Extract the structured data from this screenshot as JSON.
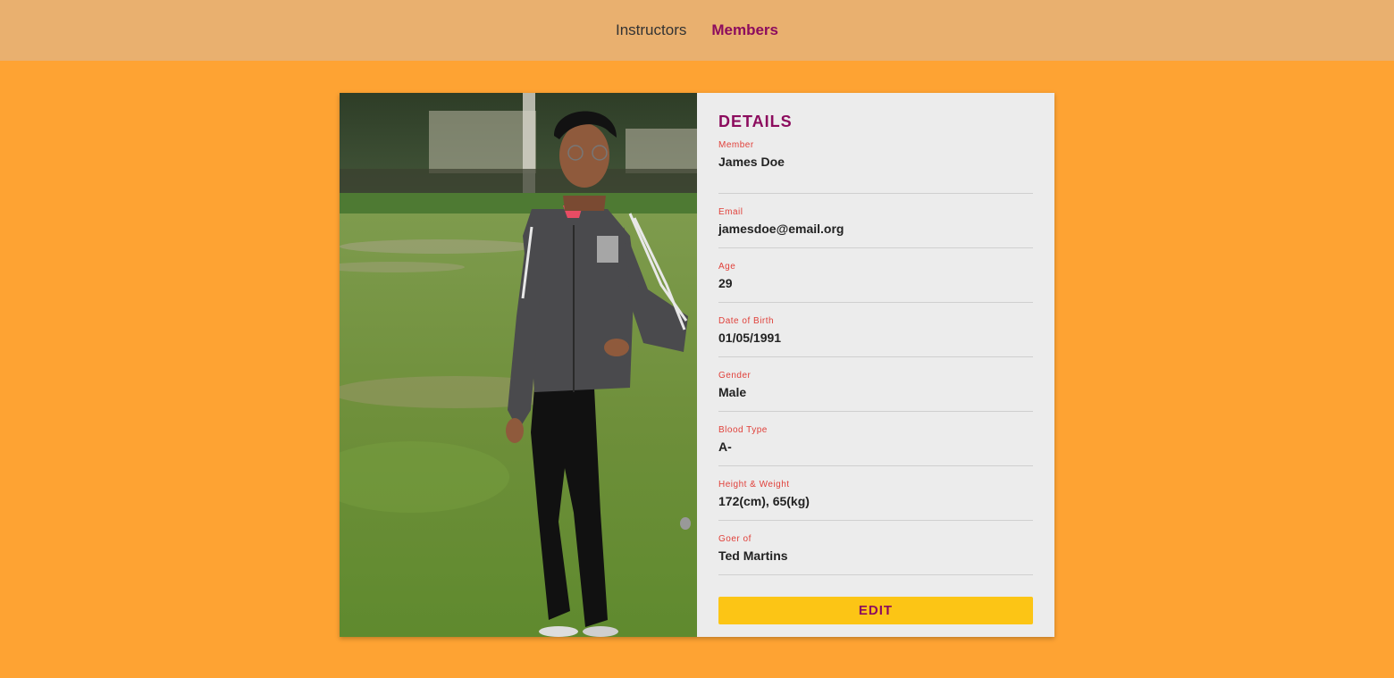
{
  "nav": {
    "items": [
      {
        "label": "Instructors",
        "active": false
      },
      {
        "label": "Members",
        "active": true
      }
    ]
  },
  "details": {
    "title": "DETAILS",
    "fields": [
      {
        "label": "Member",
        "value": "James Doe"
      },
      {
        "label": "Email",
        "value": "jamesdoe@email.org"
      },
      {
        "label": "Age",
        "value": "29"
      },
      {
        "label": "Date of Birth",
        "value": "01/05/1991"
      },
      {
        "label": "Gender",
        "value": "Male"
      },
      {
        "label": "Blood Type",
        "value": "A-"
      },
      {
        "label": "Height & Weight",
        "value": "172(cm), 65(kg)"
      },
      {
        "label": "Goer of",
        "value": "Ted Martins"
      }
    ],
    "edit_label": "EDIT"
  },
  "colors": {
    "page_background": "#fea333",
    "nav_background": "#e9b06f",
    "accent": "#8c0c5e",
    "label": "#e0403a",
    "button": "#fcc515",
    "panel": "#ececec"
  }
}
